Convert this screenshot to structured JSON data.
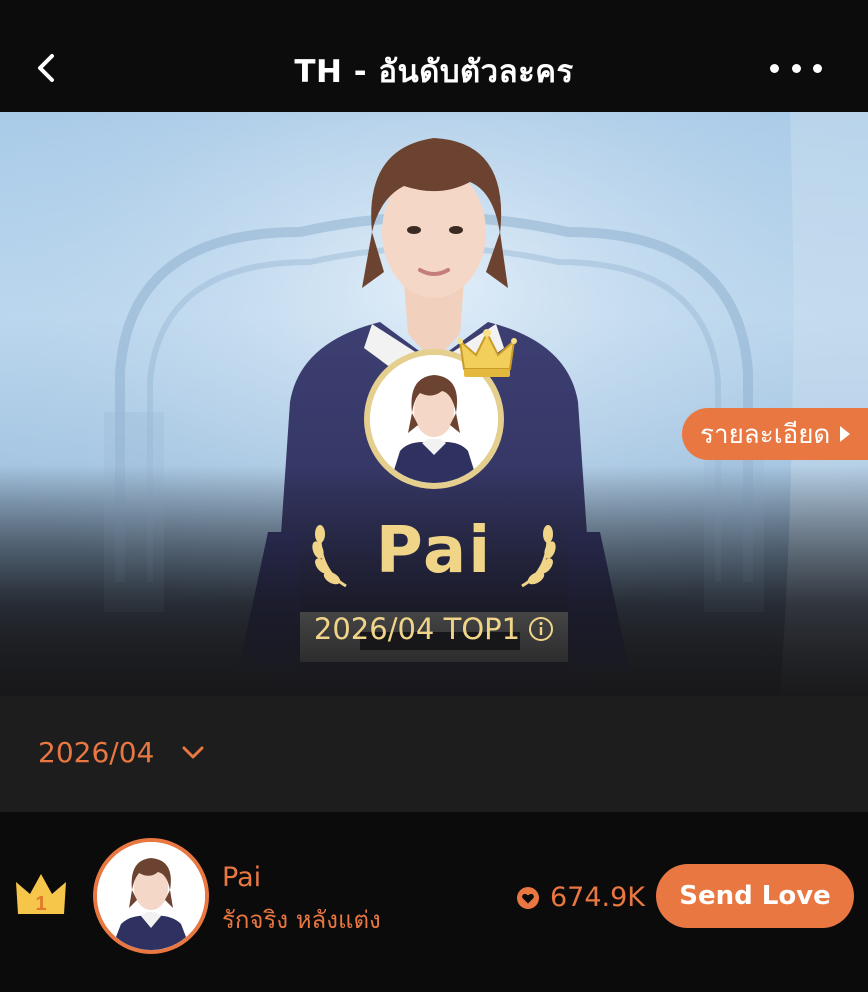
{
  "header": {
    "title": "TH - อันดับตัวละคร",
    "back_icon": "back-chevron-icon",
    "more_icon": "more-dots-icon"
  },
  "hero": {
    "details_label": "รายละเอียด",
    "name": "Pai",
    "rank_text": "2026/04 TOP1",
    "info_icon": "info-icon",
    "crown_icon": "crown-icon"
  },
  "month_selector": {
    "selected": "2026/04",
    "icon": "chevron-down-icon"
  },
  "ranking": [
    {
      "rank": "1",
      "name": "Pai",
      "series": "รักจริง หลังแต่ง",
      "love_count": "674.9K",
      "send_label": "Send Love"
    }
  ],
  "colors": {
    "accent": "#e97742",
    "gold": "#f0d589",
    "background": "#0b0b0b",
    "month_bar": "#1d1d1d"
  }
}
